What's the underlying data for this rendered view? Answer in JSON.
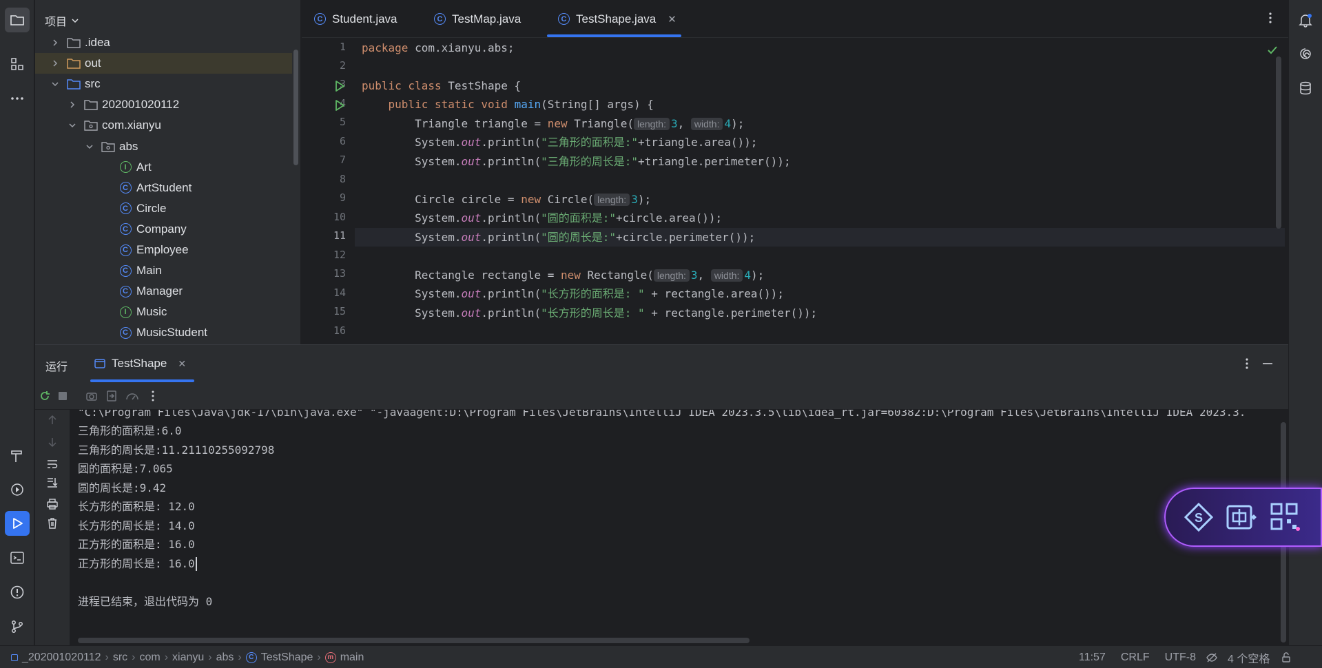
{
  "project_panel": {
    "title": "项目",
    "tree": [
      {
        "label": ".idea",
        "kind": "folder",
        "indent": 1,
        "expanded": false
      },
      {
        "label": "out",
        "kind": "folder-orange",
        "indent": 1,
        "expanded": false
      },
      {
        "label": "src",
        "kind": "folder-src",
        "indent": 1,
        "expanded": true
      },
      {
        "label": "202001020112",
        "kind": "folder",
        "indent": 2,
        "expanded": false
      },
      {
        "label": "com.xianyu",
        "kind": "package",
        "indent": 2,
        "expanded": true
      },
      {
        "label": "abs",
        "kind": "package",
        "indent": 3,
        "expanded": true
      },
      {
        "label": "Art",
        "kind": "interface",
        "indent": 4
      },
      {
        "label": "ArtStudent",
        "kind": "class",
        "indent": 4
      },
      {
        "label": "Circle",
        "kind": "class",
        "indent": 4
      },
      {
        "label": "Company",
        "kind": "class",
        "indent": 4
      },
      {
        "label": "Employee",
        "kind": "class",
        "indent": 4
      },
      {
        "label": "Main",
        "kind": "class",
        "indent": 4
      },
      {
        "label": "Manager",
        "kind": "class",
        "indent": 4
      },
      {
        "label": "Music",
        "kind": "interface",
        "indent": 4
      },
      {
        "label": "MusicStudent",
        "kind": "class",
        "indent": 4
      }
    ]
  },
  "editor": {
    "tabs": [
      {
        "label": "Student.java",
        "active": false
      },
      {
        "label": "TestMap.java",
        "active": false
      },
      {
        "label": "TestShape.java",
        "active": true
      }
    ],
    "line_numbers": [
      "1",
      "2",
      "3",
      "4",
      "5",
      "6",
      "7",
      "8",
      "9",
      "10",
      "11",
      "12",
      "13",
      "14",
      "15",
      "16"
    ],
    "current_line": "11",
    "code": {
      "l1_kw": "package",
      "l1_rest": " com.xianyu.abs;",
      "l3_kw": "public class",
      "l3_rest": " TestShape {",
      "l4_kw1": "public static void",
      "l4_fn": "main",
      "l4_rest": "(String[] args) {",
      "l5_a": "Triangle triangle = ",
      "l5_new": "new",
      "l5_b": " Triangle(",
      "l5_h1": "length:",
      "l5_n1": "3",
      "l5_c": ", ",
      "l5_h2": "width:",
      "l5_n2": "4",
      "l5_d": ");",
      "l6_a": "System.",
      "l6_out": "out",
      "l6_b": ".println(",
      "l6_s": "\"三角形的面积是:\"",
      "l6_c": "+triangle.area());",
      "l7_a": "System.",
      "l7_out": "out",
      "l7_b": ".println(",
      "l7_s": "\"三角形的周长是:\"",
      "l7_c": "+triangle.perimeter());",
      "l9_a": "Circle circle = ",
      "l9_new": "new",
      "l9_b": " Circle(",
      "l9_h1": "length:",
      "l9_n1": "3",
      "l9_d": ");",
      "l10_a": "System.",
      "l10_out": "out",
      "l10_b": ".println(",
      "l10_s": "\"圆的面积是:\"",
      "l10_c": "+circle.area());",
      "l11_a": "System.",
      "l11_out": "out",
      "l11_b": ".println(",
      "l11_s": "\"圆的周长是:\"",
      "l11_c": "+circle.perimeter());",
      "l13_a": "Rectangle rectangle = ",
      "l13_new": "new",
      "l13_b": " Rectangle(",
      "l13_h1": "length:",
      "l13_n1": "3",
      "l13_c": ", ",
      "l13_h2": "width:",
      "l13_n2": "4",
      "l13_d": ");",
      "l14_a": "System.",
      "l14_out": "out",
      "l14_b": ".println(",
      "l14_s": "\"长方形的面积是: \"",
      "l14_c": " + rectangle.area());",
      "l15_a": "System.",
      "l15_out": "out",
      "l15_b": ".println(",
      "l15_s": "\"长方形的周长是: \"",
      "l15_c": " + rectangle.perimeter());"
    }
  },
  "run_panel": {
    "title": "运行",
    "tab_label": "TestShape",
    "output": [
      "\"C:\\Program Files\\Java\\jdk-17\\bin\\java.exe\" \"-javaagent:D:\\Program Files\\JetBrains\\IntelliJ IDEA 2023.3.5\\lib\\idea_rt.jar=60382:D:\\Program Files\\JetBrains\\IntelliJ IDEA 2023.3.",
      "三角形的面积是:6.0",
      "三角形的周长是:11.21110255092798",
      "圆的面积是:7.065",
      "圆的周长是:9.42",
      "长方形的面积是: 12.0",
      "长方形的周长是: 14.0",
      "正方形的面积是: 16.0",
      "正方形的周长是: 16.0",
      "",
      "进程已结束，退出代码为 0"
    ]
  },
  "statusbar": {
    "module": "_202001020112",
    "crumbs": [
      "src",
      "com",
      "xianyu",
      "abs",
      "TestShape",
      "main"
    ],
    "position": "11:57",
    "line_sep": "CRLF",
    "encoding": "UTF-8",
    "indent": "4 个空格"
  },
  "colors": {
    "accent": "#3574f0",
    "keyword": "#cf8e6d",
    "string": "#6aab73",
    "number": "#2aacb8",
    "function": "#56a8f5",
    "field": "#c77dbb"
  }
}
